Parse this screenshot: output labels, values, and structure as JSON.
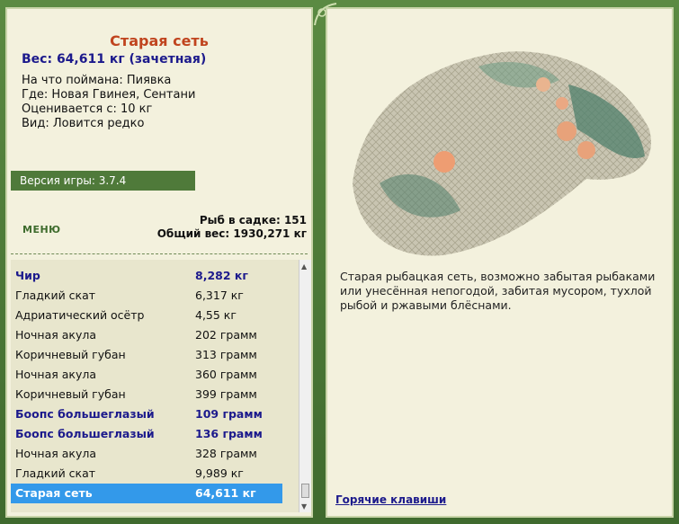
{
  "fish": {
    "title": "Старая сеть",
    "weight_line": "Вес: 64,611 кг (зачетная)",
    "bait": "На что поймана: Пиявка",
    "location": "Где: Новая Гвинея, Сентани",
    "price": "Оценивается с: 10 кг",
    "kind": "Вид: Ловится редко",
    "description": "Старая рыбацкая сеть, возможно забытая рыбаками или унесённая непогодой, забитая мусором, тухлой рыбой и ржавыми блёснами."
  },
  "version_label": "Версия игры: 3.7.4",
  "menu_label": "МЕНЮ",
  "stats": {
    "count": "Рыб в садке: 151",
    "total": "Общий вес: 1930,271 кг"
  },
  "catch_list": [
    {
      "name": "Чир",
      "weight": "8,282 кг",
      "bold": true
    },
    {
      "name": "Гладкий скат",
      "weight": "6,317 кг"
    },
    {
      "name": "Адриатический осётр",
      "weight": "4,55 кг"
    },
    {
      "name": "Ночная акула",
      "weight": "202 грамм"
    },
    {
      "name": "Коричневый губан",
      "weight": "313 грамм"
    },
    {
      "name": "Ночная акула",
      "weight": "360 грамм"
    },
    {
      "name": "Коричневый губан",
      "weight": "399 грамм"
    },
    {
      "name": "Боопс большеглазый",
      "weight": "109 грамм",
      "bold": true
    },
    {
      "name": "Боопс большеглазый",
      "weight": "136 грамм",
      "bold": true
    },
    {
      "name": "Ночная акула",
      "weight": "328 грамм"
    },
    {
      "name": "Гладкий скат",
      "weight": "9,989 кг"
    },
    {
      "name": "Старая сеть",
      "weight": "64,611 кг",
      "selected": true
    }
  ],
  "hotkeys_label": "Горячие клавиши",
  "colors": {
    "frame": "#4f7a3a",
    "panel": "#f3f1dd",
    "title": "#c0441e",
    "accent_text": "#1c1a8c",
    "selection": "#3399ea"
  }
}
